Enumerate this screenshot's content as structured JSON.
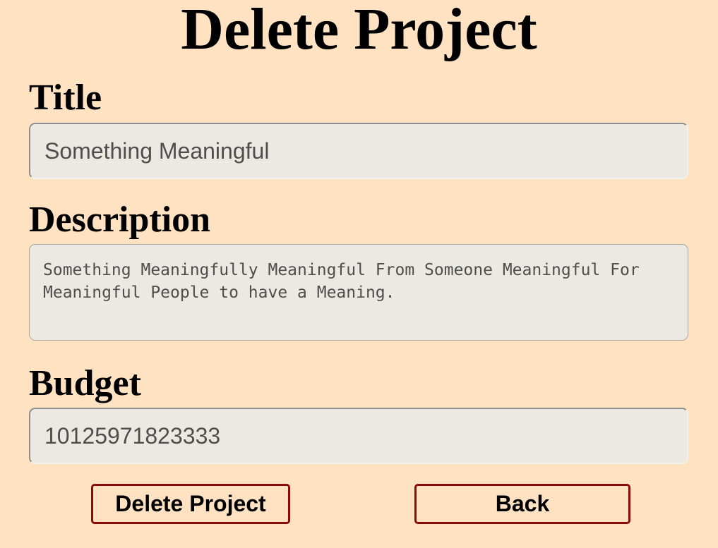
{
  "page": {
    "title": "Delete Project"
  },
  "form": {
    "title_label": "Title",
    "title_value": "Something Meaningful",
    "description_label": "Description",
    "description_value": "Something Meaningfully Meaningful From Someone Meaningful For Meaningful People to have a Meaning.",
    "budget_label": "Budget",
    "budget_value": "10125971823333"
  },
  "actions": {
    "delete_label": "Delete Project",
    "back_label": "Back"
  },
  "colors": {
    "background": "#ffe2c2",
    "input_background": "#ebe9e2",
    "button_border": "#8b0a0a"
  }
}
